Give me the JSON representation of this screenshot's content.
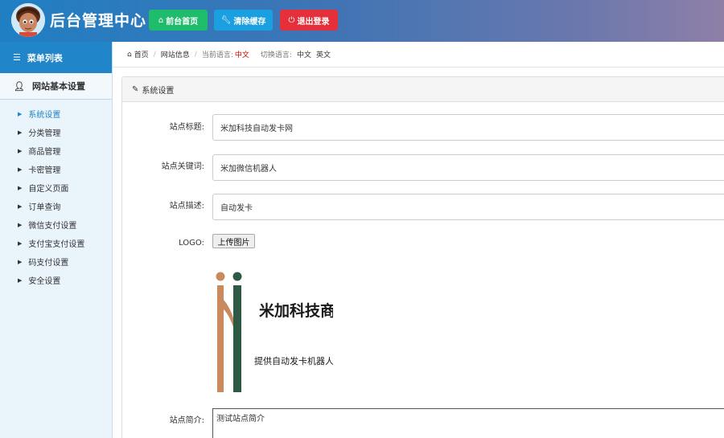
{
  "header": {
    "title": "后台管理中心",
    "buttons": {
      "home": "前台首页",
      "clear_cache": "清除缓存",
      "logout": "退出登录"
    }
  },
  "sidebar": {
    "menu_title": "菜单列表",
    "group_title": "网站基本设置",
    "items": [
      {
        "label": "系统设置",
        "active": true
      },
      {
        "label": "分类管理"
      },
      {
        "label": "商品管理"
      },
      {
        "label": "卡密管理"
      },
      {
        "label": "自定义页面"
      },
      {
        "label": "订单查询"
      },
      {
        "label": "微信支付设置"
      },
      {
        "label": "支付宝支付设置"
      },
      {
        "label": "码支付设置"
      },
      {
        "label": "安全设置"
      }
    ]
  },
  "breadcrumb": {
    "home": "首页",
    "site_info": "网站信息",
    "current_lang_label": "当前语言:",
    "current_lang": "中文",
    "switch_lang_label": "切换语言:",
    "lang_zh": "中文",
    "lang_en": "英文"
  },
  "panel": {
    "title": "系统设置",
    "fields": {
      "site_title_label": "站点标题:",
      "site_title_value": "米加科技自动发卡网",
      "keywords_label": "站点关键词:",
      "keywords_value": "米加微信机器人",
      "description_label": "站点描述:",
      "description_value": "自动发卡",
      "logo_label": "LOGO:",
      "upload_label": "上传图片",
      "intro_label": "站点简介:",
      "intro_value": "测试站点简介"
    },
    "logo": {
      "main_text": "米加科技商城",
      "sub_text": "提供自动发卡机器人"
    }
  },
  "colors": {
    "primary": "#2185c9",
    "green": "#1fbc6c",
    "cyan": "#1aa0e0",
    "red": "#e5303b",
    "logo_orange": "#c98a5e",
    "logo_green": "#2e5a45"
  }
}
